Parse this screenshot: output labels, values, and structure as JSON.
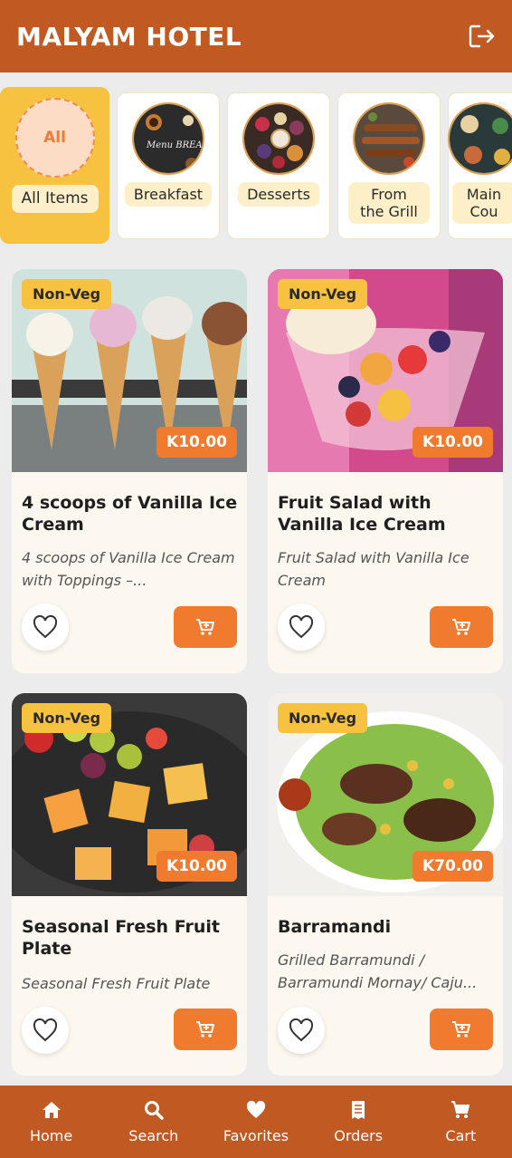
{
  "header": {
    "title": "MALYAM HOTEL",
    "logout_icon": "logout-icon"
  },
  "categories": [
    {
      "label": "All Items",
      "circle_text": "All",
      "active": true
    },
    {
      "label": "Breakfast",
      "image_text": "Menu BREAKFAST"
    },
    {
      "label": "Desserts"
    },
    {
      "label": "From the Grill"
    },
    {
      "label": "Main Cou"
    }
  ],
  "items": [
    {
      "badge": "Non-Veg",
      "price": "K10.00",
      "title": "4 scoops of Vanilla Ice Cream",
      "description": "4 scoops of Vanilla Ice Cream with Toppings –..."
    },
    {
      "badge": "Non-Veg",
      "price": "K10.00",
      "title": "Fruit Salad with Vanilla Ice Cream",
      "description": "Fruit Salad with Vanilla Ice Cream"
    },
    {
      "badge": "Non-Veg",
      "price": "K10.00",
      "title": "Seasonal Fresh Fruit Plate",
      "description": "Seasonal Fresh Fruit Plate"
    },
    {
      "badge": "Non-Veg",
      "price": "K70.00",
      "title": "Barramandi",
      "description": "Grilled Barramundi / Barramundi Mornay/ Caju..."
    }
  ],
  "nav": [
    {
      "label": "Home",
      "icon": "home-icon"
    },
    {
      "label": "Search",
      "icon": "search-icon"
    },
    {
      "label": "Favorites",
      "icon": "heart-icon"
    },
    {
      "label": "Orders",
      "icon": "receipt-icon"
    },
    {
      "label": "Cart",
      "icon": "cart-icon"
    }
  ],
  "colors": {
    "brand": "#c05a22",
    "accent": "#f07a2e",
    "badge": "#f6c240"
  }
}
